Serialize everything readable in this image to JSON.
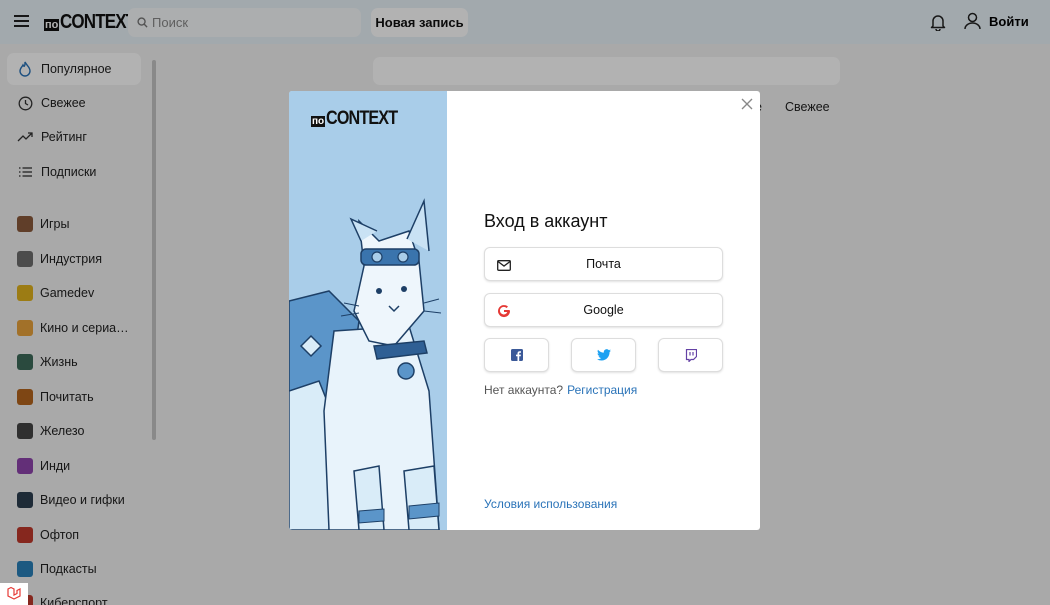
{
  "header": {
    "logo_prefix": "по",
    "logo_text": "CONTEXT",
    "search_placeholder": "Поиск",
    "new_post": "Новая запись",
    "login": "Войти"
  },
  "sidebar": {
    "nav": [
      {
        "label": "Популярное",
        "icon": "flame-icon"
      },
      {
        "label": "Свежее",
        "icon": "clock-icon"
      },
      {
        "label": "Рейтинг",
        "icon": "trend-icon"
      },
      {
        "label": "Подписки",
        "icon": "list-icon"
      }
    ],
    "categories": [
      {
        "label": "Игры",
        "color": "#8a5a3c"
      },
      {
        "label": "Индустрия",
        "color": "#6d6d6d"
      },
      {
        "label": "Gamedev",
        "color": "#e0b21e"
      },
      {
        "label": "Кино и сериа…",
        "color": "#e8a23c"
      },
      {
        "label": "Жизнь",
        "color": "#3d6b5a"
      },
      {
        "label": "Почитать",
        "color": "#b5651d"
      },
      {
        "label": "Железо",
        "color": "#444444"
      },
      {
        "label": "Инди",
        "color": "#8e44ad"
      },
      {
        "label": "Видео и гифки",
        "color": "#2c3e50"
      },
      {
        "label": "Офтоп",
        "color": "#c0392b"
      },
      {
        "label": "Подкасты",
        "color": "#2980b9"
      },
      {
        "label": "Киберспорт",
        "color": "#c0392b"
      }
    ]
  },
  "main": {
    "feed_tab_partial": "е",
    "feed_tab": "Свежее"
  },
  "modal": {
    "logo_prefix": "по",
    "logo_text": "CONTEXT",
    "title": "Вход в аккаунт",
    "mail_button": "Почта",
    "google_button": "Google",
    "no_account": "Нет аккаунта?",
    "register": "Регистрация",
    "terms": "Условия использования",
    "colors": {
      "facebook": "#3b5998",
      "twitter": "#1da1f2",
      "twitch": "#6441a5",
      "google": "#e53935",
      "link": "#2a73b8"
    }
  }
}
